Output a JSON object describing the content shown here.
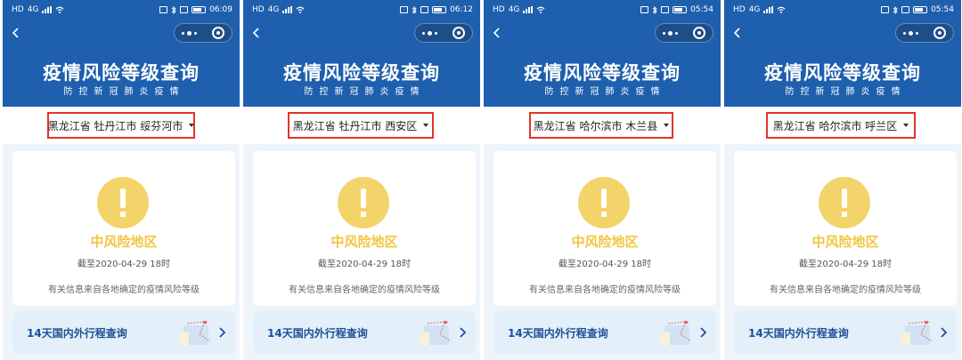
{
  "screens": [
    {
      "status": {
        "time": "06:09",
        "carrier": "HD",
        "network": "4G"
      },
      "title": "疫情风险等级查询",
      "subtitle": "防控新冠肺炎疫情",
      "region": "黑龙江省 牡丹江市 绥芬河市",
      "risk_level": "中风险地区",
      "as_of": "截至2020-04-29 18时",
      "note": "有关信息来自各地确定的疫情风险等级",
      "trip_query": "14天国内外行程查询"
    },
    {
      "status": {
        "time": "06:12",
        "carrier": "HD",
        "network": "4G"
      },
      "title": "疫情风险等级查询",
      "subtitle": "防控新冠肺炎疫情",
      "region": "黑龙江省 牡丹江市 西安区",
      "risk_level": "中风险地区",
      "as_of": "截至2020-04-29 18时",
      "note": "有关信息来自各地确定的疫情风险等级",
      "trip_query": "14天国内外行程查询"
    },
    {
      "status": {
        "time": "05:54",
        "carrier": "HD",
        "network": "4G"
      },
      "title": "疫情风险等级查询",
      "subtitle": "防控新冠肺炎疫情",
      "region": "黑龙江省 哈尔滨市 木兰县",
      "risk_level": "中风险地区",
      "as_of": "截至2020-04-29 18时",
      "note": "有关信息来自各地确定的疫情风险等级",
      "trip_query": "14天国内外行程查询"
    },
    {
      "status": {
        "time": "05:54",
        "carrier": "HD",
        "network": "4G"
      },
      "title": "疫情风险等级查询",
      "subtitle": "防控新冠肺炎疫情",
      "region": "黑龙江省 哈尔滨市 呼兰区",
      "risk_level": "中风险地区",
      "as_of": "截至2020-04-29 18时",
      "note": "有关信息来自各地确定的疫情风险等级",
      "trip_query": "14天国内外行程查询"
    }
  ],
  "colors": {
    "header_blue": "#1e5fae",
    "highlight_red": "#e0342b",
    "warning_yellow": "#f3d46a",
    "risk_text": "#f0c640",
    "trip_text": "#1e4f96"
  },
  "icons": [
    "back-arrow-icon",
    "more-dots-icon",
    "close-target-icon",
    "caret-down-icon",
    "warning-icon",
    "chevron-right-icon",
    "map-route-icon"
  ]
}
